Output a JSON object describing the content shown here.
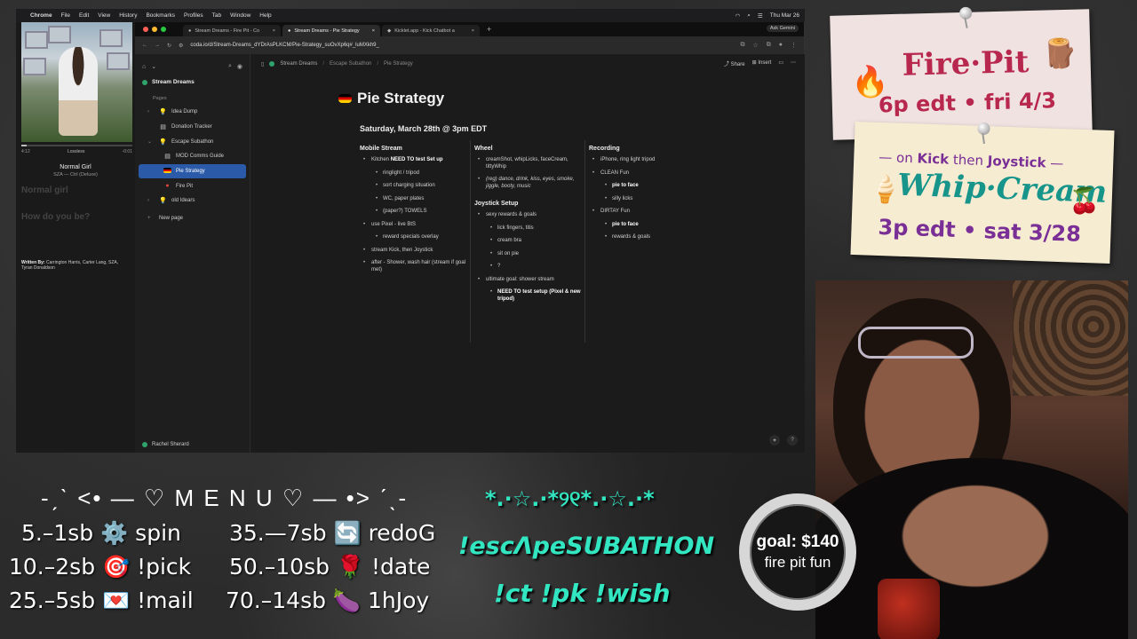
{
  "macbar": {
    "app": "Chrome",
    "menus": [
      "File",
      "Edit",
      "View",
      "History",
      "Bookmarks",
      "Profiles",
      "Tab",
      "Window",
      "Help"
    ],
    "clock": "Thu Mar 26"
  },
  "browser": {
    "tabs": [
      {
        "label": "Stream Dreams - Fire Pit - Co",
        "active": false
      },
      {
        "label": "Stream Dreams - Pie Strategy",
        "active": true
      },
      {
        "label": "Kicklet.app - Kick Chatbot a",
        "active": false
      }
    ],
    "ask_gemini": "Ask Gemini",
    "url": "coda.io/d/Stream-Dreams_dYDrAsPLKCM/Pie-Strategy_suOvXp6q#_luMXkh9_"
  },
  "sidebar": {
    "doc_title": "Stream Dreams",
    "section": "Pages",
    "items": [
      {
        "label": "Idea Dump",
        "icon": "💡",
        "level": 0,
        "caret": "›"
      },
      {
        "label": "Donation Tracker",
        "icon": "▤",
        "level": 0,
        "caret": ""
      },
      {
        "label": "Escape Subathon",
        "icon": "💡",
        "level": 0,
        "caret": "⌄"
      },
      {
        "label": "MOD Comms Guide",
        "icon": "▤",
        "level": 1,
        "caret": ""
      },
      {
        "label": "Pie Strategy",
        "icon": "▬",
        "level": 1,
        "caret": "",
        "active": true
      },
      {
        "label": "Fire Pit",
        "icon": "●",
        "level": 1,
        "caret": ""
      },
      {
        "label": "old Idears",
        "icon": "💡",
        "level": 0,
        "caret": "›"
      }
    ],
    "new_page": "New page",
    "user": "Rachel Sherard"
  },
  "doc": {
    "breadcrumb": [
      "Stream Dreams",
      "Escape Subathon",
      "Pie Strategy"
    ],
    "share": "Share",
    "insert": "Insert",
    "title": "Pie Strategy",
    "subheading": "Saturday, March 28th @ 3pm EDT",
    "columns": [
      {
        "heading": "Mobile Stream",
        "items": [
          {
            "text": "Kitchen ",
            "bold": "NEED TO test Set up",
            "level": 1
          },
          {
            "text": "ringlight / tripod",
            "level": 2
          },
          {
            "text": "sort charging situation",
            "level": 2
          },
          {
            "text": "WC, paper plates",
            "level": 2
          },
          {
            "text": "(paper?) TOWELS",
            "level": 2
          },
          {
            "text": "use Pixel - live BtS",
            "level": 1
          },
          {
            "text": "reward specials overlay",
            "level": 2
          },
          {
            "text": "stream Kick, then Joystick",
            "level": 1
          },
          {
            "text": "after - Shower, wash hair (stream if goal met)",
            "level": 1
          }
        ]
      },
      {
        "heading": "Wheel",
        "items": [
          {
            "text": "creamShot, whipLicks, faceCream, tittyWhip",
            "level": 1
          },
          {
            "text": "(reg) dance, drink, kiss, eyes, smoke, jiggle, booty, music",
            "level": 1,
            "italic": true
          }
        ],
        "heading2": "Joystick Setup",
        "items2": [
          {
            "text": "sexy rewards & goals",
            "level": 1
          },
          {
            "text": "lick fingers, titis",
            "level": 2
          },
          {
            "text": "cream bra",
            "level": 2
          },
          {
            "text": "sit on pie",
            "level": 2
          },
          {
            "text": "?",
            "level": 2
          },
          {
            "text": "ultimate goal: shower stream",
            "level": 1
          },
          {
            "text": "",
            "bold": "NEED TO test setup (Pixel & new tripod)",
            "level": 2
          }
        ]
      },
      {
        "heading": "Recording",
        "items": [
          {
            "text": "iPhone, ring light tripod",
            "level": 1
          },
          {
            "text": "CLEAN Fun",
            "level": 1
          },
          {
            "text": "",
            "bold": "pie to face",
            "level": 2
          },
          {
            "text": "silly licks",
            "level": 2
          },
          {
            "text": "DIRTAY Fun",
            "level": 1
          },
          {
            "text": "",
            "bold": "pie to face",
            "level": 2
          },
          {
            "text": "rewards & goals",
            "level": 2
          }
        ]
      }
    ]
  },
  "music": {
    "elapsed": "4:12",
    "quality": "Lossless",
    "remaining": "-0:01",
    "progress": 0.05,
    "title": "Normal Girl",
    "artist": "SZA — Ctrl (Deluxe)",
    "lyric1": "Normal girl",
    "lyric2": "How do you be?",
    "credits_label": "Written By:",
    "credits": "Carrington Harris, Carter Lang, SZA, Tyran Donaldson"
  },
  "note1": {
    "emoji_left": "🔥",
    "title": "Fire·Pit",
    "emoji_right": "🪵",
    "sub": "6p edt • fri 4/3"
  },
  "note2": {
    "top_prefix": "— on ",
    "top_kick": "Kick",
    "top_mid": " then ",
    "top_joy": "Joystick",
    "top_suffix": " —",
    "emoji_left": "🍦",
    "title": "Whip·Cream",
    "emoji_right": "🍒",
    "sub": "3p edt • sat 3/28"
  },
  "goal": {
    "amount": "goal: $140",
    "label": "fire pit fun"
  },
  "menu": {
    "title": "-ˏˋ <• — ♡ M E N U ♡ — •> ˊˎ-",
    "left": [
      "5.–1sb ⚙️ spin",
      "10.–2sb 🎯 !pick",
      "25.–5sb 💌 !mail"
    ],
    "right": [
      "35.—7sb 🔄 redoG",
      "50.–10sb 🌹 !date",
      "70.–14sb 🍆 1hJoy"
    ]
  },
  "center": {
    "deco": "*.·☆.·*୨୧*.·☆.·*",
    "subathon": "!escΛpeSUBATHON",
    "commands": "!ct !pk !wish"
  },
  "colors": {
    "accent_cyan": "#33e6c2",
    "sidebar_active": "#2b5aa8",
    "coda_green": "#2fa36b",
    "firepit_red": "#b8284e",
    "whip_teal": "#18958b",
    "whip_purple": "#7a2f96"
  }
}
